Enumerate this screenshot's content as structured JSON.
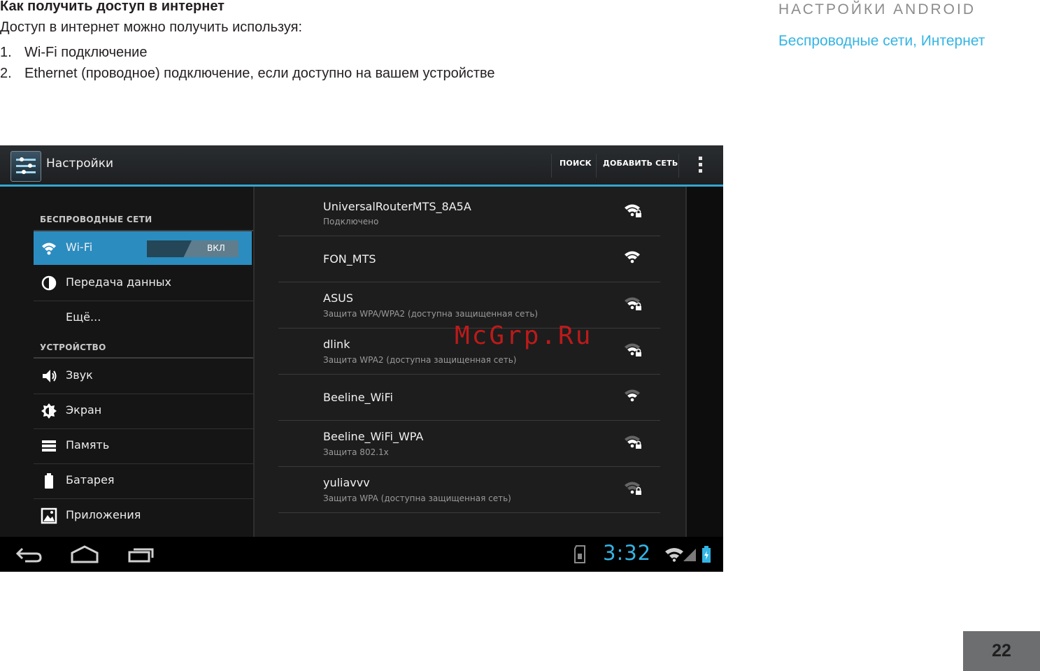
{
  "document": {
    "heading": "Как получить доступ в интернет",
    "intro": "Доступ в интернет можно получить используя:",
    "list": [
      {
        "num": "1.",
        "text": "Wi-Fi подключение"
      },
      {
        "num": "2.",
        "text": "Ethernet (проводное) подключение, если доступно на вашем устройстве"
      }
    ],
    "section_title": "НАСТРОЙКИ ANDROID",
    "section_subtitle": "Беспроводные сети, Интернет",
    "page_number": "22",
    "watermark": "McGrp.Ru"
  },
  "screen": {
    "action_bar": {
      "title": "Настройки",
      "search_label": "ПОИСК",
      "add_network_label": "ДОБАВИТЬ СЕТЬ",
      "overflow_icon": "overflow-menu-icon"
    },
    "sidebar": {
      "category_wireless": "БЕСПРОВОДНЫЕ СЕТИ",
      "category_device": "УСТРОЙСТВО",
      "items": [
        {
          "label": "Wi-Fi",
          "icon": "wifi-icon",
          "selected": true
        },
        {
          "label": "Передача данных",
          "icon": "data-usage-icon"
        },
        {
          "label": "Ещё..."
        },
        {
          "label": "Звук",
          "icon": "sound-icon"
        },
        {
          "label": "Экран",
          "icon": "display-icon"
        },
        {
          "label": "Память",
          "icon": "storage-icon"
        },
        {
          "label": "Батарея",
          "icon": "battery-icon"
        },
        {
          "label": "Приложения",
          "icon": "apps-icon"
        }
      ],
      "wifi_toggle": {
        "state_label": "ВКЛ",
        "on": true
      }
    },
    "networks": [
      {
        "ssid": "UniversalRouterMTS_8A5A",
        "status": "Подключено",
        "secured": true,
        "signal": 4
      },
      {
        "ssid": "FON_MTS",
        "status": "",
        "secured": false,
        "signal": 4
      },
      {
        "ssid": "ASUS",
        "status": "Защита WPA/WPA2 (доступна защищенная сеть)",
        "secured": true,
        "signal": 3
      },
      {
        "ssid": "dlink",
        "status": "Защита WPA2 (доступна защищенная сеть)",
        "secured": true,
        "signal": 3
      },
      {
        "ssid": "Beeline_WiFi",
        "status": "",
        "secured": false,
        "signal": 3
      },
      {
        "ssid": "Beeline_WiFi_WPA",
        "status": "Защита 802.1x",
        "secured": true,
        "signal": 3
      },
      {
        "ssid": "yuliavvv",
        "status": "Защита WPA (доступна защищенная сеть)",
        "secured": true,
        "signal": 2
      }
    ],
    "nav_bar": {
      "clock": "3:32",
      "back_icon": "back-icon",
      "home_icon": "home-icon",
      "recent_icon": "recent-apps-icon"
    },
    "colors": {
      "accent": "#33b5e5",
      "selected": "#2b8cc0",
      "heading_blue": "#33b4e4"
    }
  }
}
